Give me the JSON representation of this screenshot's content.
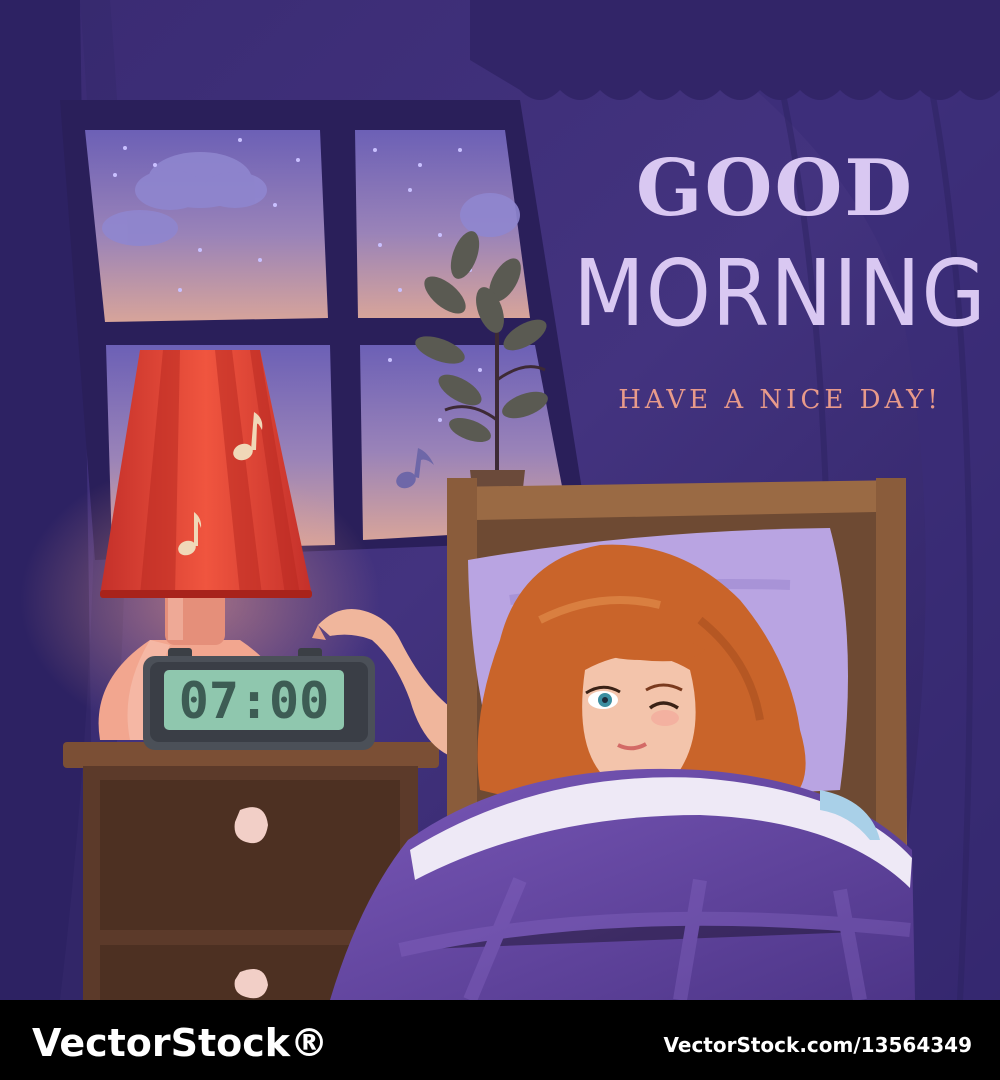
{
  "headline": {
    "line1": "GOOD",
    "line2": "MORNING",
    "subtitle": "HAVE A NICE DAY!"
  },
  "clock": {
    "time": "07:00"
  },
  "watermark": {
    "brand": "VectorStock®",
    "url": "VectorStock.com/13564349"
  },
  "colors": {
    "wall": "#3e2e78",
    "wall_dark": "#2a1f5a",
    "sky_top": "#6f63b8",
    "sky_bottom": "#c79a9c",
    "lamp_shade": "#e0473a",
    "blanket": "#6a4ba6",
    "hair": "#c9642a",
    "headline": "#d9c8f2",
    "subtitle": "#e89a8a",
    "clock_display": "#8fc7ae",
    "nightstand": "#5c3a2a",
    "bed_wood": "#9a6a44"
  },
  "icons": {
    "music_notes": "music-note-icon",
    "moon_none": "",
    "plant": "plant-icon"
  }
}
